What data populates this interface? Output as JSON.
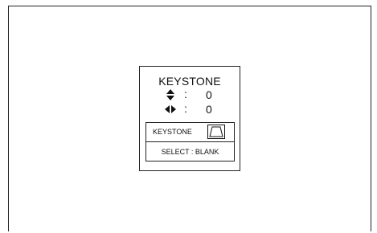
{
  "osd": {
    "title": "KEYSTONE",
    "vertical": {
      "icon": "vertical-arrows-icon",
      "separator": ":",
      "value": "0"
    },
    "horizontal": {
      "icon": "horizontal-arrows-icon",
      "separator": ":",
      "value": "0"
    },
    "keystone_label": "KEYSTONE",
    "keystone_icon": "trapezoid-icon",
    "select_text": "SELECT : BLANK"
  }
}
